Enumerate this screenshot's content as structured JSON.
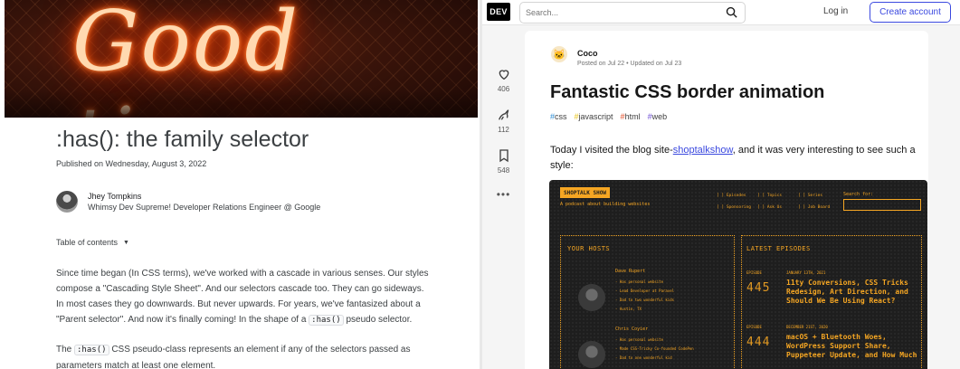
{
  "left": {
    "hero_text": "Good times",
    "title": ":has(): the family selector",
    "published": "Published on Wednesday, August 3, 2022",
    "author": {
      "name": "Jhey Tompkins",
      "role": "Whimsy Dev Supreme! Developer Relations Engineer @ Google"
    },
    "toc_label": "Table of contents",
    "para1": {
      "line1": "Since time began (In CSS terms), we've worked with a cascade in various senses. Our styles",
      "line2": "compose a \"Cascading Style Sheet\". And our selectors cascade too. They can go sideways.",
      "line3": "In most cases they go downwards. But never upwards. For years, we've fantasized about a",
      "line4_pre": "\"Parent selector\". And now it's finally coming! In the shape of a",
      "line4_code": ":has()",
      "line4_post": "pseudo selector."
    },
    "para2": {
      "pre": "The",
      "code": ":has()",
      "post": "CSS pseudo-class represents an element if any of the selectors passed as",
      "line2": "parameters match at least one element."
    }
  },
  "right": {
    "logo": "DEV",
    "search_placeholder": "Search...",
    "login": "Log in",
    "create_account": "Create account",
    "rail": {
      "likes": "406",
      "unicorns": "112",
      "saves": "548"
    },
    "post": {
      "author": "Coco",
      "dates": "Posted on Jul 22 • Updated on Jul 23",
      "title": "Fantastic CSS border animation",
      "tags": [
        "#css",
        "#javascript",
        "#html",
        "#web"
      ],
      "body_pre": "Today I visited the blog site-",
      "body_link": "shoptalkshow",
      "body_post": ", and it was very interesting to see such a",
      "body_line2": "style:"
    },
    "embed": {
      "logo": "SHOPTALK SHOW",
      "tagline": "A podcast about building websites",
      "nav": [
        "[ ] Episodes",
        "[ ] Topics",
        "[ ] Series",
        "[ ] Sponsoring",
        "[ ] Ask Us",
        "[ ] Job Board"
      ],
      "search_label": "Search for:",
      "hosts_heading": "YOUR HOSTS",
      "episodes_heading": "LATEST EPISODES",
      "host1": {
        "name": "Dave Rupert",
        "lines": [
          "- Has personal website",
          "- Lead Developer at Paravel",
          "- Dad to two wonderful kids",
          "- Austin, TX"
        ]
      },
      "host2": {
        "name": "Chris Coyier",
        "lines": [
          "- Has personal website",
          "- Made CSS-Tricky Co-founded CodePen",
          "- Dad to one wonderful kid"
        ]
      },
      "ep1": {
        "label": "EPISODE",
        "num": "445",
        "date": "JANUARY 13TH, 2021",
        "title": "11ty Conversions, CSS Tricks Redesign, Art Direction, and Should We Be Using React?"
      },
      "ep2": {
        "label": "EPISODE",
        "num": "444",
        "date": "DECEMBER 21ST, 2020",
        "title": "macOS + Bluetooth Woes, WordPress Support Share, Puppeteer Update, and How Much"
      }
    }
  }
}
